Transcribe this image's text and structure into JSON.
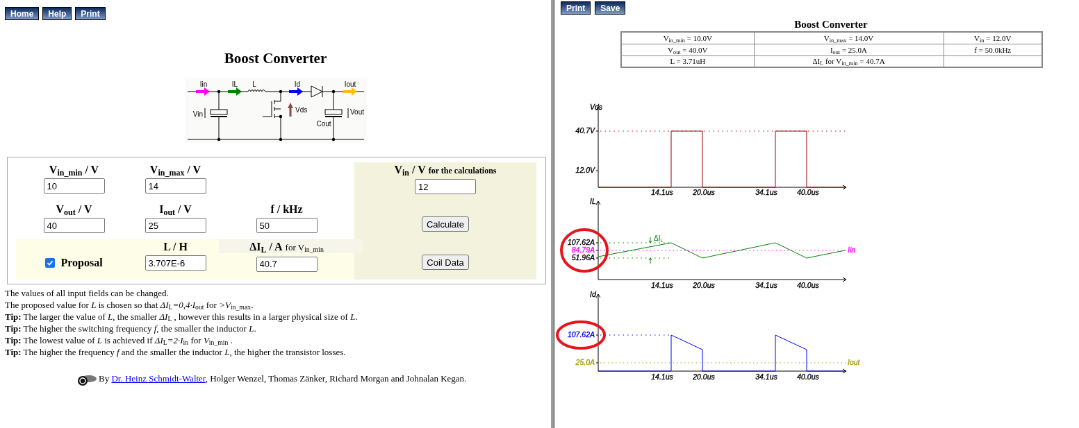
{
  "nav_buttons": [
    {
      "label": "Home"
    },
    {
      "label": "Help"
    },
    {
      "label": "Print"
    }
  ],
  "title": "Boost Converter",
  "schematic": {
    "labels": [
      "Iin",
      "IL",
      "L",
      "Id",
      "Iout",
      "Vin",
      "Vds",
      "Cout",
      "Vout"
    ]
  },
  "form": {
    "fields": [
      {
        "label": "V$_{in_min}$ / V",
        "value": "10"
      },
      {
        "label": "V$_{in_max}$ / V",
        "value": "14"
      },
      {
        "label": "V$_{in}$ / V",
        "suffix": "for the calculations",
        "value": "12"
      },
      {
        "label": "V$_{out}$ / V",
        "value": "40"
      },
      {
        "label": "I$_{out}$ / V",
        "value": "25"
      },
      {
        "label": "f / kHz",
        "value": "50"
      },
      {
        "label": "L / H",
        "value": "3.707E-6"
      },
      {
        "label": "ΔI$_{L}$ / A",
        "suffix": "for V$_{in_min}$",
        "value": "40.7"
      }
    ],
    "proposal": {
      "label": "Proposal",
      "checked": true
    },
    "buttons": [
      "Calculate",
      "Coil Data"
    ]
  },
  "notes": [
    "The values of all input fields can be changed.",
    "The proposed value for *L* is chosen so that *ΔI*$_{L}$*=0,4·I*$_{out}$ for *>V*$_{in_max}$.",
    "**Tip:** The larger the value of *L*, the smaller *ΔI*$_{L}$ , however this results in a larger physical size of *L*.",
    "**Tip:** The higher the switching frequency *f*, the smaller the inductor *L*.",
    "**Tip:** The lowest value of *L* is achieved if *ΔI*$_{L}$*=2·I*$_{in}$ for *V*$_{in_min}$ .",
    "**Tip:** The higher the frequency  *f* and the smaller the inductor *L*, the higher the transistor losses."
  ],
  "credits": {
    "prefix": "By",
    "link": "Dr. Heinz Schmidt-Walter",
    "rest": ", Holger Wenzel, Thomas Zänker, Richard Morgan and Johnalan Kegan."
  },
  "result_buttons": [
    {
      "label": "Print"
    },
    {
      "label": "Save"
    }
  ],
  "result_title": "Boost Converter",
  "summary_table": [
    [
      "V$_{in_min}$ = 10.0V",
      "V$_{in_max}$ = 14.0V",
      "V$_{in}$ = 12.0V"
    ],
    [
      "V$_{out}$ = 40.0V",
      "I$_{out}$ = 25.0A",
      "f = 50.0kHz"
    ],
    [
      "L = 3.71uH",
      "ΔI$_{L}$ for V$_{in_min}$ = 40.7A"
    ]
  ],
  "charts": [
    {
      "kind": "vds",
      "y_label": "Vds",
      "y_ticks": [
        {
          "text": "40.7V",
          "color": "#000000"
        },
        {
          "text": "12.0V",
          "color": "#000000"
        }
      ],
      "x_ticks": [
        "14.1us",
        "20.0us",
        "34.1us",
        "40.0us"
      ]
    },
    {
      "kind": "il",
      "y_label": "IL",
      "y_ticks": [
        {
          "text": "107.62A",
          "color": "#000000"
        },
        {
          "text": "84.79A",
          "color": "#ff00ff"
        },
        {
          "text": "51.96A",
          "color": "#000000"
        }
      ],
      "series_label": "Iin",
      "delta": {
        "text": "ΔI",
        "sub": "L"
      },
      "x_ticks": [
        "14.1us",
        "20.0us",
        "34.1us",
        "40.0us"
      ],
      "highlighted": true
    },
    {
      "kind": "id",
      "y_label": "Id",
      "y_ticks": [
        {
          "text": "107.62A",
          "color": "#0000ff"
        },
        {
          "text": "25.0A",
          "color": "#a0a000"
        }
      ],
      "series_label": "Iout",
      "x_ticks": [
        "14.1us",
        "20.0us",
        "34.1us",
        "40.0us"
      ],
      "highlighted": true
    }
  ]
}
